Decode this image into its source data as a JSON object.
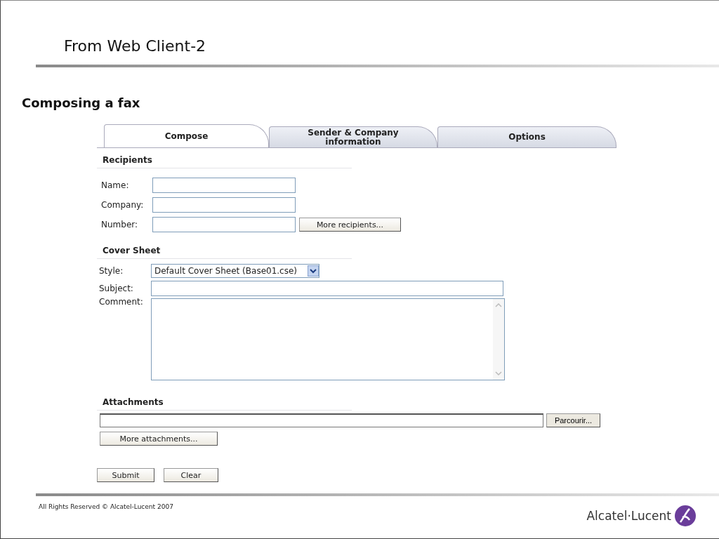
{
  "slide": {
    "title": "From Web Client-2",
    "heading": "Composing a fax"
  },
  "tabs": [
    {
      "label": "Compose",
      "selected": true
    },
    {
      "label": "Sender & Company information",
      "selected": false
    },
    {
      "label": "Options",
      "selected": false
    }
  ],
  "recipients": {
    "heading": "Recipients",
    "fields": [
      {
        "label": "Name:"
      },
      {
        "label": "Company:"
      },
      {
        "label": "Number:"
      }
    ],
    "more_button": "More recipients..."
  },
  "cover_sheet": {
    "heading": "Cover Sheet",
    "style": {
      "label": "Style:",
      "value": "Default Cover Sheet (Base01.cse)"
    },
    "subject": {
      "label": "Subject:"
    },
    "comment": {
      "label": "Comment:"
    }
  },
  "attachments": {
    "heading": "Attachments",
    "browse_button": "Parcourir...",
    "more_button": "More attachments..."
  },
  "actions": [
    "Submit",
    "Clear"
  ],
  "footer": {
    "copyright": "All Rights Reserved © Alcatel-Lucent 2007",
    "logo_text": "Alcatel·Lucent"
  }
}
